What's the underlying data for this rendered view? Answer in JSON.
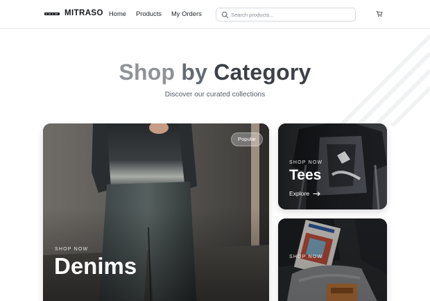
{
  "header": {
    "brand": "MITRASO",
    "nav": {
      "home": "Home",
      "products": "Products",
      "orders": "My Orders"
    },
    "search": {
      "placeholder": "Search products..."
    }
  },
  "hero": {
    "title_words": [
      "Shop",
      "by",
      "Category"
    ],
    "subtitle": "Discover our curated collections"
  },
  "categories": [
    {
      "eyebrow": "SHOP NOW",
      "title": "Denims",
      "badge": "Popular"
    },
    {
      "eyebrow": "SHOP NOW",
      "title": "Tees",
      "cta": "Explore"
    },
    {
      "eyebrow": "SHOP NOW"
    }
  ],
  "icons": {
    "logo": "brand-logo-icon",
    "search": "search-icon",
    "cart": "cart-icon",
    "arrow": "arrow-right-icon"
  },
  "colors": {
    "title_light": "#8f9398",
    "title_mid": "#656b73",
    "title_dark": "#3c4047"
  }
}
